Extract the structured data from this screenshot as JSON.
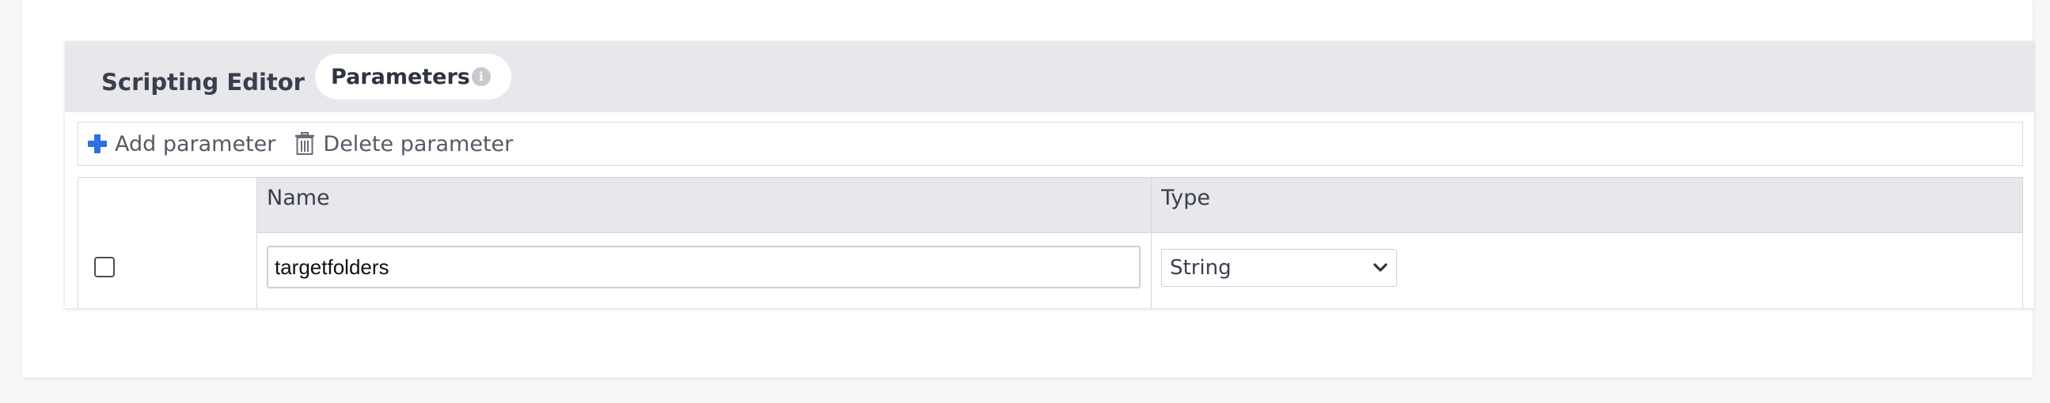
{
  "editor": {
    "title": "Scripting Editor",
    "active_tab": "Parameters",
    "info_glyph": "i"
  },
  "toolbar": {
    "add_label": "Add parameter",
    "add_icon": "plus-icon",
    "add_icon_color": "#2f6fe4",
    "delete_label": "Delete parameter",
    "delete_icon": "trash-icon"
  },
  "table": {
    "columns": [
      "",
      "Name",
      "Type"
    ],
    "rows": [
      {
        "checked": false,
        "name": "targetfolders",
        "type": "String"
      }
    ]
  },
  "colors": {
    "header_bg": "#e7e7ec",
    "page_bg": "#f7f7f8",
    "text": "#3a3f4d",
    "accent": "#2f6fe4"
  }
}
